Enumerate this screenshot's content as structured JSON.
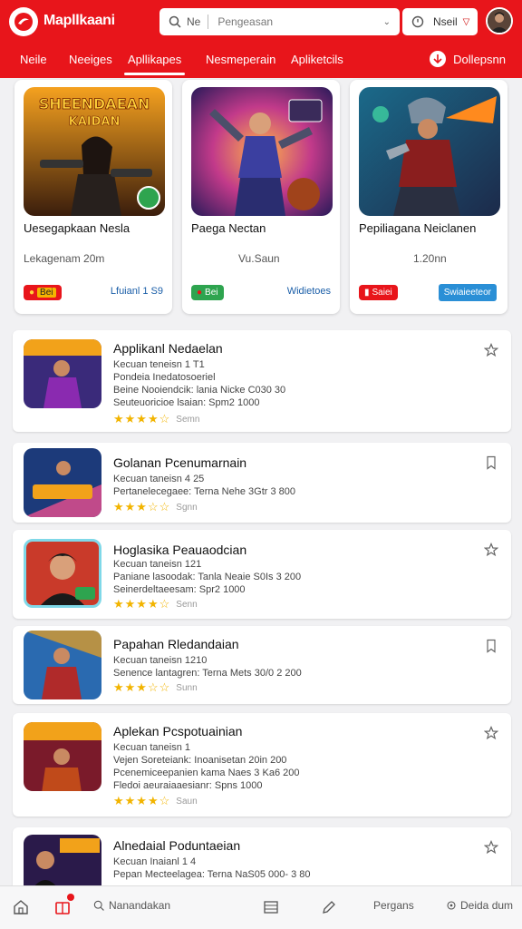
{
  "header": {
    "app_title": "Mapllkaani",
    "search_scope": "Ne",
    "search_placeholder": "Pengeasan",
    "filter_label": "Nseil"
  },
  "tabs": [
    {
      "label": "Neile"
    },
    {
      "label": "Neeiges"
    },
    {
      "label": "Apllikapes",
      "active": true
    },
    {
      "label": "Nesmeperain"
    },
    {
      "label": "Apliketcils"
    }
  ],
  "tab_right_label": "Dollepsnn",
  "featured": [
    {
      "art_caption": "SHEENDAEAN\nKAIDAN",
      "title": "Uesegapkaan Nesla",
      "meta": "Lekagenam  20m",
      "pill": "Bei",
      "pill_color": "#e8151b",
      "price": "Lfuianl 1 S9"
    },
    {
      "art_caption": "",
      "title": "Paega Nectan",
      "meta": "Vu.Saun",
      "pill": "Bei",
      "pill_color": "#2ea44f",
      "price": "Widietoes"
    },
    {
      "art_caption": "",
      "title": "Pepiliagana Neiclanen",
      "meta": "1.20nn",
      "pill": "Saiei",
      "pill_color": "#e8151b",
      "price": "Swiaieeteor"
    }
  ],
  "list": [
    {
      "title": "Applikanl Nedaelan",
      "lines": [
        "Kecuan  teneisn  1 T1",
        "Pondeia  Inedatosoeriel",
        "Beine  Nooiendcik:  lania  Nicke  C030  30",
        "Seuteuoricioe  lsaian:  Spm2  1000"
      ],
      "stars": "★★★★☆",
      "rating_text": "Semn",
      "action": "star-outline-icon"
    },
    {
      "title": "Golanan Pcenumarnain",
      "lines": [
        "Kecuan  taneisn  4 25",
        "Pertanelecegaee:  Terna  Nehe  3Gtr  3 800"
      ],
      "stars": "★★★☆☆",
      "rating_text": "Sgnn",
      "action": "bookmark-icon"
    },
    {
      "title": "Hoglasika Peauaodcian",
      "lines": [
        "Kecuan  taneisn  121",
        "Paniane  lasoodak:  Tanla  Neaie  S0Is  3 200",
        "Seinerdeltaeesam:  Spr2  1000"
      ],
      "stars": "★★★★☆",
      "rating_text": "Senn",
      "action": "star-outline-icon"
    },
    {
      "title": "Papahan Rledandaian",
      "lines": [
        "Kecuan  taneisn  1210",
        "Senence  lantagren:  Terna  Mets  30/0  2 200"
      ],
      "stars": "★★★☆☆",
      "rating_text": "Sunn",
      "action": "bookmark-icon"
    },
    {
      "title": "Aplekan Pcspotuainian",
      "lines": [
        "Kecuan  taneisn  1",
        "Vejen  Soreteiank:  Inoanisetan  20in  200",
        "Pcenemiceepanien  kama  Naes  3  Ka6  200",
        "Fledoi  aeuraiaaesianr:  Spns  1000"
      ],
      "stars": "★★★★☆",
      "rating_text": "Saun",
      "action": "star-outline-icon"
    },
    {
      "title": "Alnedaial Poduntaeian",
      "lines": [
        "Kecuan  Inaianl  1 4",
        "Pepan  Mecteelagea:  Terna  NaS05  000-  3 80"
      ],
      "stars": "",
      "rating_text": "",
      "action": "star-outline-icon"
    }
  ],
  "bottom_nav": {
    "search_label": "Nanandakan",
    "profile_label": "Pergans",
    "more_label": "Deida dum"
  }
}
